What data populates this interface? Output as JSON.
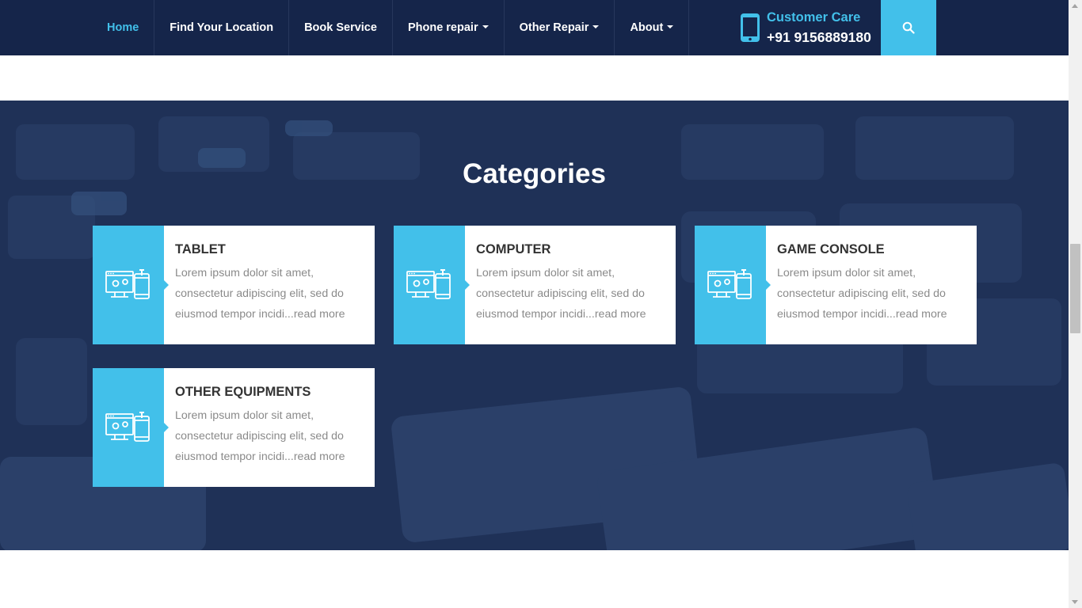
{
  "nav": {
    "items": [
      {
        "label": "Home",
        "active": true,
        "dropdown": false
      },
      {
        "label": "Find Your Location",
        "active": false,
        "dropdown": false
      },
      {
        "label": "Book Service",
        "active": false,
        "dropdown": false
      },
      {
        "label": "Phone repair",
        "active": false,
        "dropdown": true
      },
      {
        "label": "Other Repair",
        "active": false,
        "dropdown": true
      },
      {
        "label": "About",
        "active": false,
        "dropdown": true
      }
    ],
    "customer_care": {
      "title": "Customer Care",
      "number": "+91 9156889180",
      "icon": "mobile-phone-icon"
    },
    "search_icon": "search-icon"
  },
  "categories": {
    "title": "Categories",
    "cards": [
      {
        "title": "TABLET",
        "description": "Lorem ipsum dolor sit amet, consectetur adipiscing elit, sed do eiusmod tempor incidi...",
        "link": "read more",
        "icon": "devices-gear-icon"
      },
      {
        "title": "COMPUTER",
        "description": "Lorem ipsum dolor sit amet, consectetur adipiscing elit, sed do eiusmod tempor incidi...",
        "link": "read more",
        "icon": "devices-gear-icon"
      },
      {
        "title": "GAME CONSOLE",
        "description": "Lorem ipsum dolor sit amet, consectetur adipiscing elit, sed do eiusmod tempor incidi...",
        "link": "read more",
        "icon": "devices-gear-icon"
      },
      {
        "title": "OTHER EQUIPMENTS",
        "description": "Lorem ipsum dolor sit amet, consectetur adipiscing elit, sed do eiusmod tempor incidi...",
        "link": "read more",
        "icon": "devices-gear-icon"
      }
    ]
  },
  "colors": {
    "navbar": "#15254a",
    "accent": "#42c0ea",
    "section_bg": "#1f3157",
    "card_bg": "#ffffff"
  }
}
